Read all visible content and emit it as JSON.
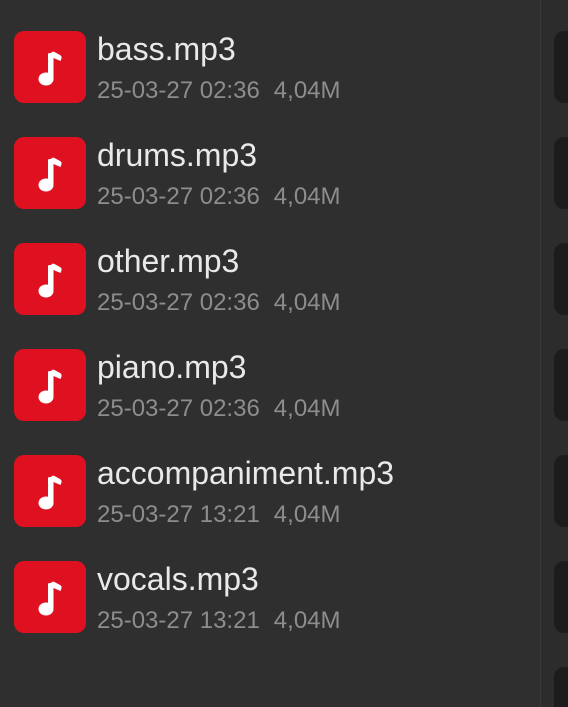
{
  "files": [
    {
      "name": "bass.mp3",
      "date": "25-03-27 02:36",
      "size": "4,04M",
      "icon": "music-note-icon"
    },
    {
      "name": "drums.mp3",
      "date": "25-03-27 02:36",
      "size": "4,04M",
      "icon": "music-note-icon"
    },
    {
      "name": "other.mp3",
      "date": "25-03-27 02:36",
      "size": "4,04M",
      "icon": "music-note-icon"
    },
    {
      "name": "piano.mp3",
      "date": "25-03-27 02:36",
      "size": "4,04M",
      "icon": "music-note-icon"
    },
    {
      "name": "accompaniment.mp3",
      "date": "25-03-27 13:21",
      "size": "4,04M",
      "icon": "music-note-icon"
    },
    {
      "name": "vocals.mp3",
      "date": "25-03-27 13:21",
      "size": "4,04M",
      "icon": "music-note-icon"
    }
  ],
  "colors": {
    "background": "#2f2f2f",
    "icon_tile": "#df1120",
    "file_name": "#e9e9e9",
    "file_meta": "#8d8d8d"
  }
}
